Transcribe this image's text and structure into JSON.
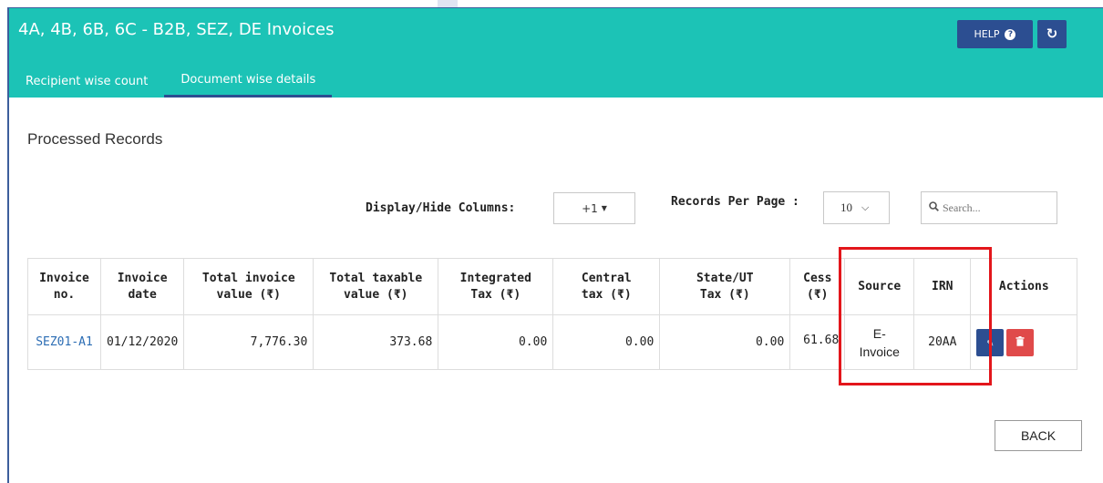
{
  "header": {
    "title": "4A, 4B, 6B, 6C - B2B, SEZ, DE Invoices",
    "help_label": "HELP",
    "help_icon": "question-circle-icon",
    "refresh_icon": "refresh-icon",
    "bg_color": "#1cc3b6",
    "button_color": "#2c4e91"
  },
  "tabs": [
    {
      "label": "Recipient wise count",
      "active": false
    },
    {
      "label": "Document wise details",
      "active": true
    }
  ],
  "main": {
    "section_title": "Processed Records",
    "display_hide_label": "Display/Hide Columns:",
    "columns_button_label": "+1",
    "records_per_page_label": "Records Per Page :",
    "records_per_page_value": "10",
    "search_placeholder": "Search..."
  },
  "table": {
    "headers": [
      "Invoice\nno.",
      "Invoice\ndate",
      "Total invoice\nvalue (₹)",
      "Total taxable\nvalue (₹)",
      "Integrated\nTax (₹)",
      "Central\ntax (₹)",
      "State/UT\nTax (₹)",
      "Cess\n(₹)",
      "Source",
      "IRN",
      "Actions"
    ],
    "rows": [
      {
        "invoice_no": "SEZ01-A1",
        "invoice_date": "01/12/2020",
        "total_invoice_value": "7,776.30",
        "total_taxable_value": "373.68",
        "integrated_tax": "0.00",
        "central_tax": "0.00",
        "state_ut_tax": "0.00",
        "cess": "61.68",
        "source": "E-\nInvoice",
        "irn": "20AA"
      }
    ]
  },
  "footer": {
    "back_label": "BACK"
  },
  "highlight_color": "#e3161b"
}
